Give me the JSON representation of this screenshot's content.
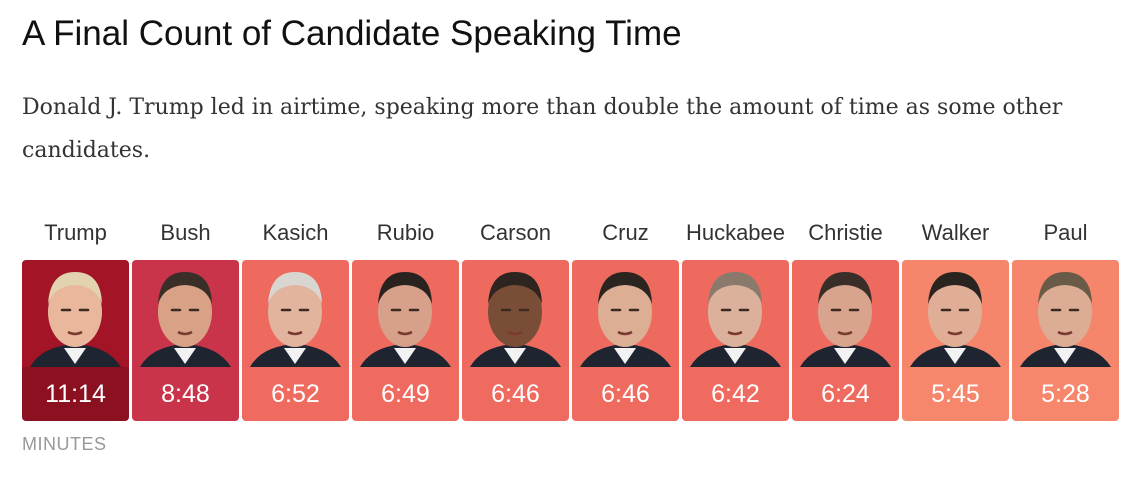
{
  "title": "A Final Count of Candidate Speaking Time",
  "subtitle": "Donald J. Trump led in airtime, speaking more than double the amount of time as some other candidates.",
  "chart_data": {
    "type": "bar",
    "title": "A Final Count of Candidate Speaking Time",
    "unit_label": "MINUTES",
    "categories": [
      "Trump",
      "Bush",
      "Kasich",
      "Rubio",
      "Carson",
      "Cruz",
      "Huckabee",
      "Christie",
      "Walker",
      "Paul"
    ],
    "values": [
      "11:14",
      "8:48",
      "6:52",
      "6:49",
      "6:46",
      "6:46",
      "6:42",
      "6:24",
      "5:45",
      "5:28"
    ],
    "colors": [
      "#8b1020",
      "#c9344a",
      "#ef6b60",
      "#ef6b60",
      "#ef6b60",
      "#ef6b60",
      "#ef6b60",
      "#ef6b60",
      "#f7876c",
      "#f7876c"
    ],
    "photo_backgrounds": [
      "#a31426",
      "#c9344a",
      "#ee6a5e",
      "#ee6a5e",
      "#ee6a5e",
      "#ee6a5e",
      "#ee6a5e",
      "#ee6a5e",
      "#f5856b",
      "#f5856b"
    ]
  }
}
